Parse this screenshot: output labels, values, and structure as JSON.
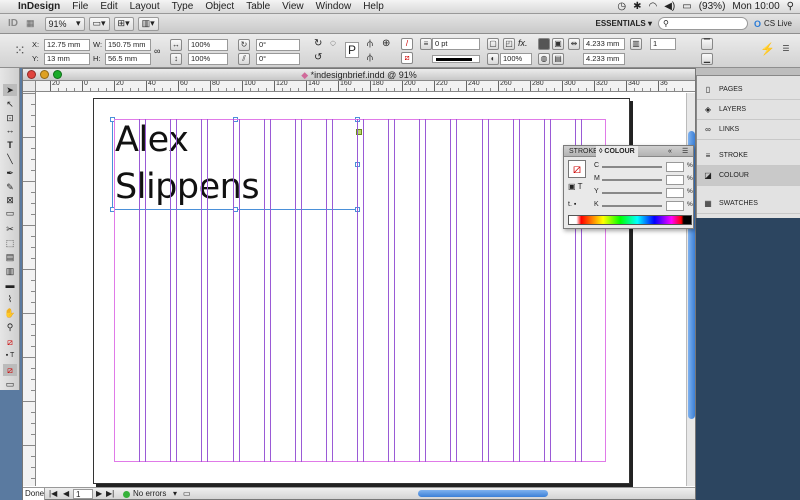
{
  "menubar": {
    "app_name": "InDesign",
    "items": [
      "File",
      "Edit",
      "Layout",
      "Type",
      "Object",
      "Table",
      "View",
      "Window",
      "Help"
    ],
    "battery": "(93%)",
    "clock": "Mon 10:00"
  },
  "appbar": {
    "logo": "ID",
    "zoom": "91%",
    "workspace": "ESSENTIALS ▾",
    "search_placeholder": "",
    "cslive": "CS Live"
  },
  "control": {
    "x_label": "X:",
    "x_value": "12.75 mm",
    "y_label": "Y:",
    "y_value": "13 mm",
    "w_label": "W:",
    "w_value": "150.75 mm",
    "h_label": "H:",
    "h_value": "56.5 mm",
    "scale_x": "100%",
    "scale_y": "100%",
    "rotate": "0°",
    "shear": "0°",
    "stroke_weight": "0 pt",
    "opacity": "100%",
    "gutter": "4.233 mm",
    "columns": "1",
    "gutter2": "4.233 mm"
  },
  "document": {
    "title": "*indesignbrief.indd @ 91%",
    "ruler_ticks": [
      "20",
      "0",
      "20",
      "40",
      "60",
      "80",
      "100",
      "120",
      "140",
      "160",
      "180",
      "200",
      "220",
      "240",
      "260",
      "280",
      "300",
      "320",
      "340",
      "36"
    ],
    "text_line1": "Alex",
    "text_line2": "Slippens",
    "status_zoom": "Done",
    "page_num": "1",
    "preflight": "No errors"
  },
  "colour_panel": {
    "tab_stroke": "STROKE",
    "tab_colour": "◊ COLOUR",
    "channels": [
      "C",
      "M",
      "Y",
      "K"
    ],
    "pct": "%"
  },
  "dock": {
    "items": [
      "PAGES",
      "LAYERS",
      "LINKS",
      "STROKE",
      "COLOUR",
      "SWATCHES"
    ]
  },
  "colors": {
    "guide_magenta": "#e07ae8",
    "guide_purple": "#9a5ad6",
    "frame_blue": "#4a90d9",
    "dock_bg": "#2c4560"
  }
}
